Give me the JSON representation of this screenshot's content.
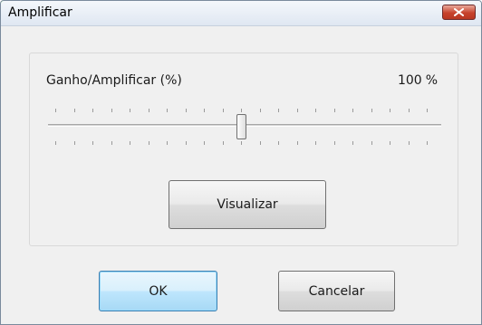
{
  "window": {
    "title": "Amplificar"
  },
  "gain": {
    "label": "Ganho/Amplificar (%)",
    "value": "100",
    "unit": "%",
    "slider_fraction": 0.5
  },
  "buttons": {
    "preview_label": "Visualizar",
    "ok_label": "OK",
    "cancel_label": "Cancelar"
  },
  "icons": {
    "close": "close-icon"
  },
  "colors": {
    "close_button": "#c7432d",
    "default_button_border": "#3c7fb1",
    "corner_accent": "#2fc42f"
  }
}
